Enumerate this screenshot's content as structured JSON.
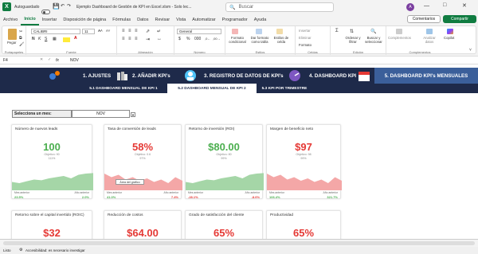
{
  "titlebar": {
    "autosave_label": "Autoguardado",
    "autosave_state": "off",
    "document_title": "Ejemplo Dashboard de Gestión de KPI en Excel.xlsm - Solo lec...",
    "search_placeholder": "Buscar",
    "user_initial": "A"
  },
  "menu": {
    "items": [
      "Archivo",
      "Inicio",
      "Insertar",
      "Disposición de página",
      "Fórmulas",
      "Datos",
      "Revisar",
      "Vista",
      "Automatizar",
      "Programador",
      "Ayuda"
    ],
    "active": "Inicio",
    "comments_label": "Comentarios",
    "share_label": "Compartir"
  },
  "ribbon": {
    "groups": {
      "clipboard": {
        "label": "Portapapeles",
        "paste": "Pegar"
      },
      "font": {
        "label": "Fuente",
        "font_name": "CALIBRI",
        "font_size": "11"
      },
      "alignment": {
        "label": "Alineación"
      },
      "number": {
        "label": "Número",
        "format": "General"
      },
      "styles": {
        "label": "Estilos",
        "conditional": "Formato condicional",
        "table": "Dar formato como tabla",
        "cell": "Estilos de celda"
      },
      "cells": {
        "label": "Celdas",
        "insert": "Insertar",
        "delete": "Eliminar",
        "format": "Formato"
      },
      "editing": {
        "label": "Edición",
        "sort": "Ordenar y filtrar",
        "find": "Buscar y seleccionar"
      },
      "addins": {
        "label": "Complementos",
        "addins": "Complementos",
        "analyze": "Analizar datos",
        "copilot": "Copilot"
      }
    }
  },
  "formula_bar": {
    "cell_ref": "F4",
    "fx": "fx",
    "value": "NOV"
  },
  "dashboard": {
    "nav": [
      {
        "label": "1. AJUSTES"
      },
      {
        "label": "2. AÑADIR KPI's"
      },
      {
        "label": "3. REGISTRO DE DATOS DE KPI's"
      },
      {
        "label": "4. DASHBOARD KPI"
      },
      {
        "label": "5. DASHBOARD KPI's MENSUALES"
      }
    ],
    "subnav": [
      {
        "label": "5.1 DASHBOARD MENSUAL DE KPI 1"
      },
      {
        "label": "5.2 DASHBOARD MENSUAL DE KPI 2"
      },
      {
        "label": "5.3 KPI POR TRIMESTRE"
      }
    ],
    "month_label": "Selecciona un mes:",
    "month_value": "NOV",
    "tooltip": "Área del gráfico",
    "cards": [
      {
        "title": "Número de nuevos leads",
        "value": "100",
        "objective": "Objetivo: 90",
        "pct": "111%",
        "color": "#4caf50",
        "foot_left_label": "Mes anterior",
        "foot_left_value": "23.5%",
        "foot_right_label": "Año anterior",
        "foot_right_value": "2.0%",
        "left_color": "#4caf50",
        "right_color": "#4caf50",
        "trend": "up"
      },
      {
        "title": "Tasa de conversión de leads",
        "value": "58%",
        "objective": "Objetivo: 0.6",
        "pct": "97%",
        "color": "#e53935",
        "foot_left_label": "Mes anterior",
        "foot_left_value": "41.0%",
        "foot_right_label": "Año anterior",
        "foot_right_value": "7.4%",
        "left_color": "#4caf50",
        "right_color": "#e53935",
        "trend": "down"
      },
      {
        "title": "Retorno de inversión (ROI)",
        "value": "$80.00",
        "objective": "Objetivo: 80",
        "pct": "99%",
        "color": "#4caf50",
        "foot_left_label": "Mes anterior",
        "foot_left_value": "-28.1%",
        "foot_right_label": "Año anterior",
        "foot_right_value": "-8.6%",
        "left_color": "#e53935",
        "right_color": "#e53935",
        "trend": "up"
      },
      {
        "title": "Margen de beneficio neto",
        "value": "$97",
        "objective": "Objetivo: 98",
        "pct": "99%",
        "color": "#e53935",
        "foot_left_label": "Mes anterior",
        "foot_left_value": "106.4%",
        "foot_right_label": "Año anterior",
        "foot_right_value": "321.7%",
        "left_color": "#4caf50",
        "right_color": "#4caf50",
        "trend": "down"
      },
      {
        "title": "Retorno sobre el capital invertido (ROIC)",
        "value": "$32",
        "color": "#e53935"
      },
      {
        "title": "Reducción de costos",
        "value": "$64.00",
        "color": "#e53935"
      },
      {
        "title": "Grado de satisfacción del cliente",
        "value": "65%",
        "color": "#e53935"
      },
      {
        "title": "Productividad",
        "value": "65%",
        "color": "#e53935"
      }
    ]
  },
  "status": {
    "ready": "Listo",
    "accessibility": "Accesibilidad: es necesario investigar"
  }
}
